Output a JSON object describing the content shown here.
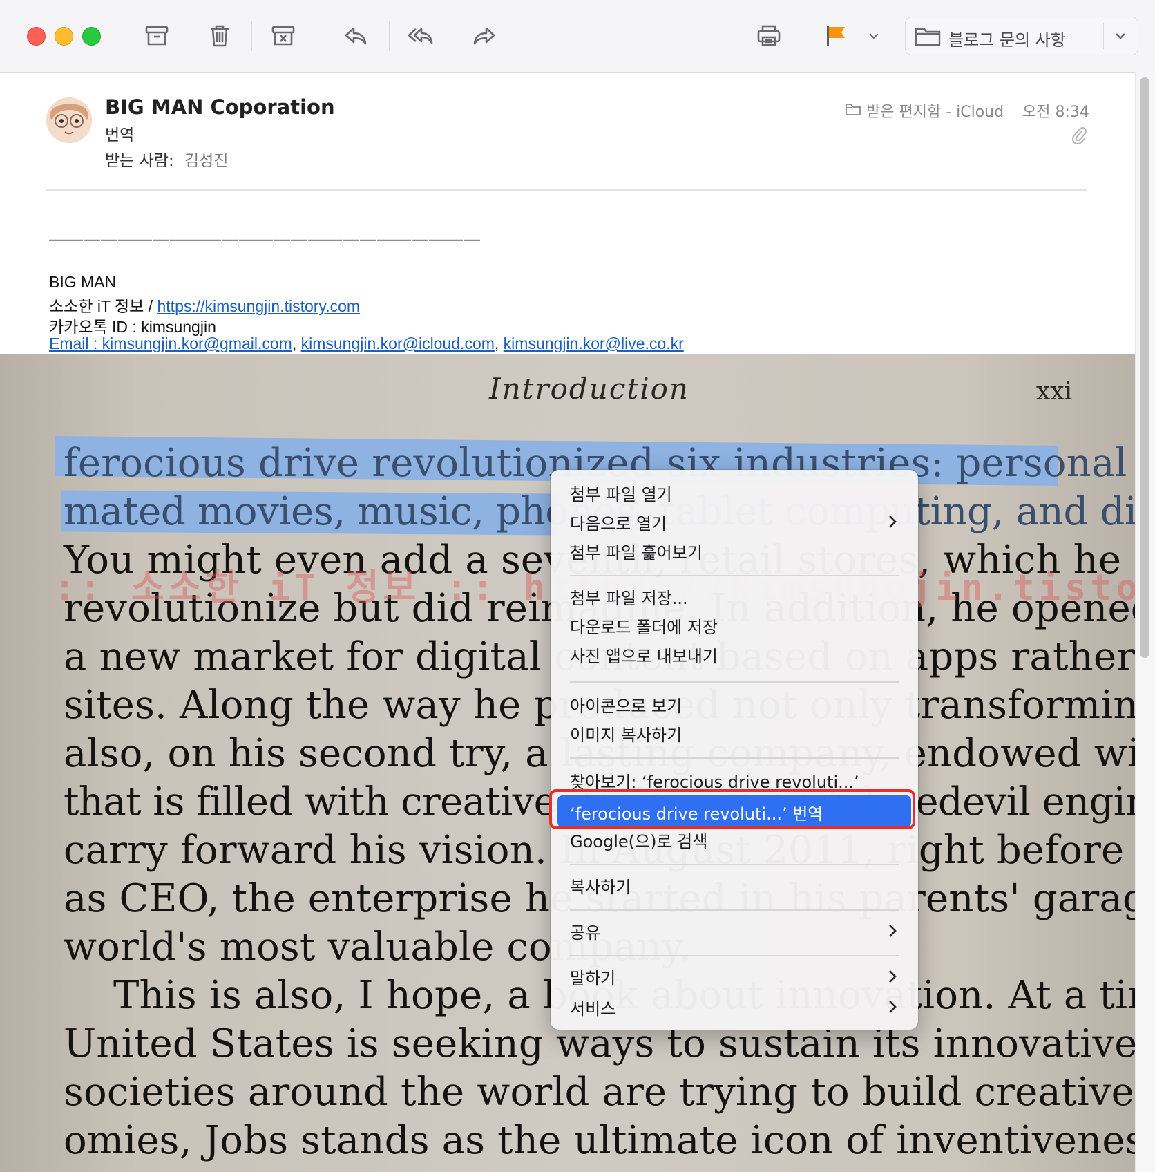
{
  "toolbar": {
    "mailbox_label": "블로그 문의 사항",
    "flag_color": "#f7930f",
    "icons": [
      "archive-icon",
      "trash-icon",
      "junk-icon",
      "reply-icon",
      "reply-all-icon",
      "forward-icon",
      "print-icon",
      "flag-icon",
      "chevron-down-icon",
      "folder-icon"
    ]
  },
  "header": {
    "sender": "BIG MAN Coporation",
    "subject": "번역",
    "to_label": "받는 사람:",
    "to_value": "김성진",
    "mailbox": "받은 편지함 - iCloud",
    "time": "오전 8:34"
  },
  "body": {
    "dashes": "—————————————————————————",
    "sig_name": "BIG MAN",
    "sig_blog_prefix": "소소한 iT 정보 / ",
    "sig_blog_link": "https://kimsungjin.tistory.com",
    "sig_kakao": "카카오톡 ID : kimsungjin",
    "sig_email1": "Email : kimsungjin.kor@gmail.com",
    "sig_comma": ", ",
    "sig_email2": "kimsungjin.kor@icloud.com",
    "sig_email3": "kimsungjin.kor@live.co.kr",
    "link_color": "#1b5fc1"
  },
  "book": {
    "title": "Introduction",
    "page": "xxi",
    "watermark": ":: 소소한 iT 정보 :: https://kimsungjin.tistory.com ::",
    "lines": [
      "ferocious drive revolutionized six industries: personal computers, ani-",
      "mated movies, music, phones, tablet computing, and digital publishing.",
      "You might even add a seventh, retail stores, which he did not quite",
      "revolutionize but did reimagine. In addition, he opened the way for",
      "a new market for digital content based on apps rather than just web-",
      "sites. Along the way he produced not only transforming products but",
      "also, on his second try, a lasting company, endowed with his DNA,",
      "that is filled with creative designers and daredevil engineers who could",
      "carry forward his vision. In August 2011, right before he stepped down",
      "as CEO, the enterprise he started in his parents' garage became the",
      "world's most valuable company.",
      "This is also, I hope, a book about innovation. At a time when the",
      "United States is seeking ways to sustain its innovative edge, and when",
      "societies around the world are trying to build creative digital-age econ-",
      "omies, Jobs stands as the ultimate icon of inventiveness, imagination,"
    ],
    "highlight_color": "#8eb2e2"
  },
  "context_menu": {
    "items": [
      {
        "label": "첨부 파일 열기"
      },
      {
        "label": "다음으로 열기"
      },
      {
        "label": "첨부 파일 훑어보기"
      },
      {
        "label": "첨부 파일 저장..."
      },
      {
        "label": "다운로드 폴더에 저장"
      },
      {
        "label": "사진 앱으로 내보내기"
      },
      {
        "label": "아이콘으로 보기"
      },
      {
        "label": "이미지 복사하기"
      },
      {
        "label": "찾아보기: ‘ferocious drive revoluti...’"
      },
      {
        "label": "‘ferocious drive revoluti...’ 번역"
      },
      {
        "label": "Google(으)로 검색"
      },
      {
        "label": "복사하기"
      },
      {
        "label": "공유"
      },
      {
        "label": "말하기"
      },
      {
        "label": "서비스"
      }
    ],
    "selected_color": "#2f6ff2",
    "highlight_frame_color": "#e2312b"
  }
}
